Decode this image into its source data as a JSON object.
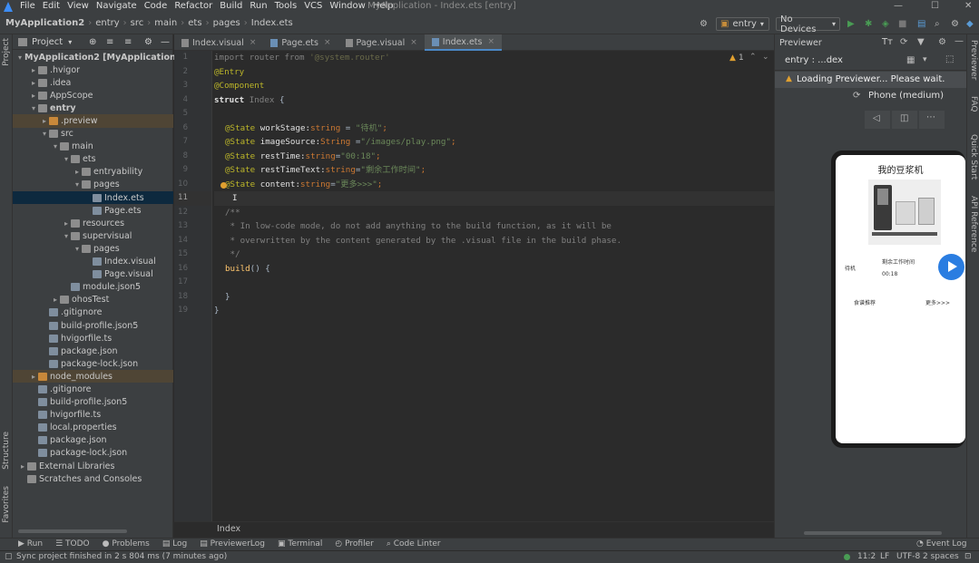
{
  "menubar": {
    "items": [
      "File",
      "Edit",
      "View",
      "Navigate",
      "Code",
      "Refactor",
      "Build",
      "Run",
      "Tools",
      "VCS",
      "Window",
      "Help"
    ],
    "title": "MyApplication - Index.ets [entry]"
  },
  "navbar": {
    "crumbs": [
      "MyApplication2",
      "entry",
      "src",
      "main",
      "ets",
      "pages",
      "Index.ets"
    ],
    "run_config": "entry",
    "device": "No Devices"
  },
  "project": {
    "header": "Project",
    "items": [
      {
        "label": "MyApplication2 [MyApplication]",
        "suffix": " D:\\H...",
        "type": "folder"
      },
      {
        "label": ".hvigor",
        "type": "folder"
      },
      {
        "label": ".idea",
        "type": "folder"
      },
      {
        "label": "AppScope",
        "type": "folder"
      },
      {
        "label": "entry",
        "type": "folder"
      },
      {
        "label": ".preview",
        "type": "folder"
      },
      {
        "label": "src",
        "type": "folder"
      },
      {
        "label": "main",
        "type": "folder"
      },
      {
        "label": "ets",
        "type": "folder"
      },
      {
        "label": "entryability",
        "type": "folder"
      },
      {
        "label": "pages",
        "type": "folder"
      },
      {
        "label": "Index.ets",
        "type": "file"
      },
      {
        "label": "Page.ets",
        "type": "file"
      },
      {
        "label": "resources",
        "type": "folder"
      },
      {
        "label": "supervisual",
        "type": "folder"
      },
      {
        "label": "pages",
        "type": "folder"
      },
      {
        "label": "Index.visual",
        "type": "file"
      },
      {
        "label": "Page.visual",
        "type": "file"
      },
      {
        "label": "module.json5",
        "type": "file"
      },
      {
        "label": "ohosTest",
        "type": "folder"
      },
      {
        "label": ".gitignore",
        "type": "file"
      },
      {
        "label": "build-profile.json5",
        "type": "file"
      },
      {
        "label": "hvigorfile.ts",
        "type": "file"
      },
      {
        "label": "package.json",
        "type": "file"
      },
      {
        "label": "package-lock.json",
        "type": "file"
      },
      {
        "label": "node_modules",
        "type": "folder"
      },
      {
        "label": ".gitignore",
        "type": "file"
      },
      {
        "label": "build-profile.json5",
        "type": "file"
      },
      {
        "label": "hvigorfile.ts",
        "type": "file"
      },
      {
        "label": "local.properties",
        "type": "file"
      },
      {
        "label": "package.json",
        "type": "file"
      },
      {
        "label": "package-lock.json",
        "type": "file"
      },
      {
        "label": "External Libraries",
        "type": "folder"
      },
      {
        "label": "Scratches and Consoles",
        "type": "folder"
      }
    ]
  },
  "tabs": [
    "Index.visual",
    "Page.ets",
    "Page.visual",
    "Index.ets"
  ],
  "editor": {
    "lines": [
      "1",
      "2",
      "3",
      "4",
      "5",
      "6",
      "7",
      "8",
      "9",
      "10",
      "11",
      "12",
      "13",
      "14",
      "15",
      "16",
      "17",
      "18",
      "19"
    ],
    "code": {
      "l1a": "import router from ",
      "l1b": "'@system.router'",
      "l2": "@Entry",
      "l3": "@Component",
      "l4a": "struct ",
      "l4b": "Index",
      "l4c": " {",
      "l6a": "@State ",
      "l6b": "workStage:",
      "l6c": "string",
      "l6d": " = ",
      "l6e": "\"待机\"",
      "l6f": ";",
      "l7a": "@State ",
      "l7b": "imageSource:",
      "l7c": "String",
      "l7d": " =",
      "l7e": "\"/images/play.png\"",
      "l7f": ";",
      "l8a": "@State ",
      "l8b": "restTime:",
      "l8c": "string",
      "l8d": "=",
      "l8e": "\"00:18\"",
      "l8f": ";",
      "l9a": "@State ",
      "l9b": "restTimeText:",
      "l9c": "string",
      "l9d": "=",
      "l9e": "\"剩余工作时间\"",
      "l9f": ";",
      "l10a": "@State ",
      "l10b": "content:",
      "l10c": "string",
      "l10d": "=",
      "l10e": "\"更多>>>\"",
      "l10f": ";",
      "l12": "/**",
      "l13": " * In low-code mode, do not add anything to the build function, as it will be",
      "l14": " * overwritten by the content generated by the .visual file in the build phase.",
      "l15": " */",
      "l16a": "build",
      "l16b": "() {",
      "l18": "}",
      "l19": "}"
    },
    "warnings": "1",
    "breadcrumb": "Index"
  },
  "previewer": {
    "title": "Previewer",
    "file": "entry : ...dex",
    "loading": "Loading Previewer... Please wait.",
    "device": "Phone (medium)",
    "app": {
      "title": "我的豆浆机",
      "status": "待机",
      "rest_label": "剩余工作时间",
      "rest_time": "00:18",
      "tip": "食谱推荐",
      "more": "更多>>>"
    }
  },
  "side_left": [
    "Project",
    "Structure",
    "Favorites"
  ],
  "side_right": [
    "Previewer",
    "FAQ",
    "Quick Start",
    "API Reference"
  ],
  "bottom": [
    "Run",
    "TODO",
    "Problems",
    "Log",
    "PreviewerLog",
    "Terminal",
    "Profiler",
    "Code Linter"
  ],
  "event_log": "Event Log",
  "status": {
    "message": "Sync project finished in 2 s 804 ms (7 minutes ago)",
    "position": "11:2",
    "line_sep": "LF",
    "encoding": "UTF-8",
    "indent": "2 spaces"
  }
}
